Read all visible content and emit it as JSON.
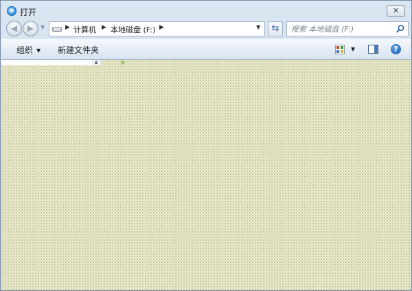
{
  "window": {
    "title": "打开",
    "app_icon": "ie-icon",
    "close_label": "✕"
  },
  "address": {
    "breadcrumbs": [
      "计算机",
      "本地磁盘 (F:)"
    ],
    "search_placeholder": "搜索 本地磁盘 (F:)"
  },
  "toolbar": {
    "organize_label": "组织",
    "new_folder_label": "新建文件夹",
    "help_label": "?"
  },
  "colors": {
    "accent": "#1a7ad6",
    "content_bg": "#f1f1d8",
    "toolbar_bg": "#e5edf7"
  }
}
